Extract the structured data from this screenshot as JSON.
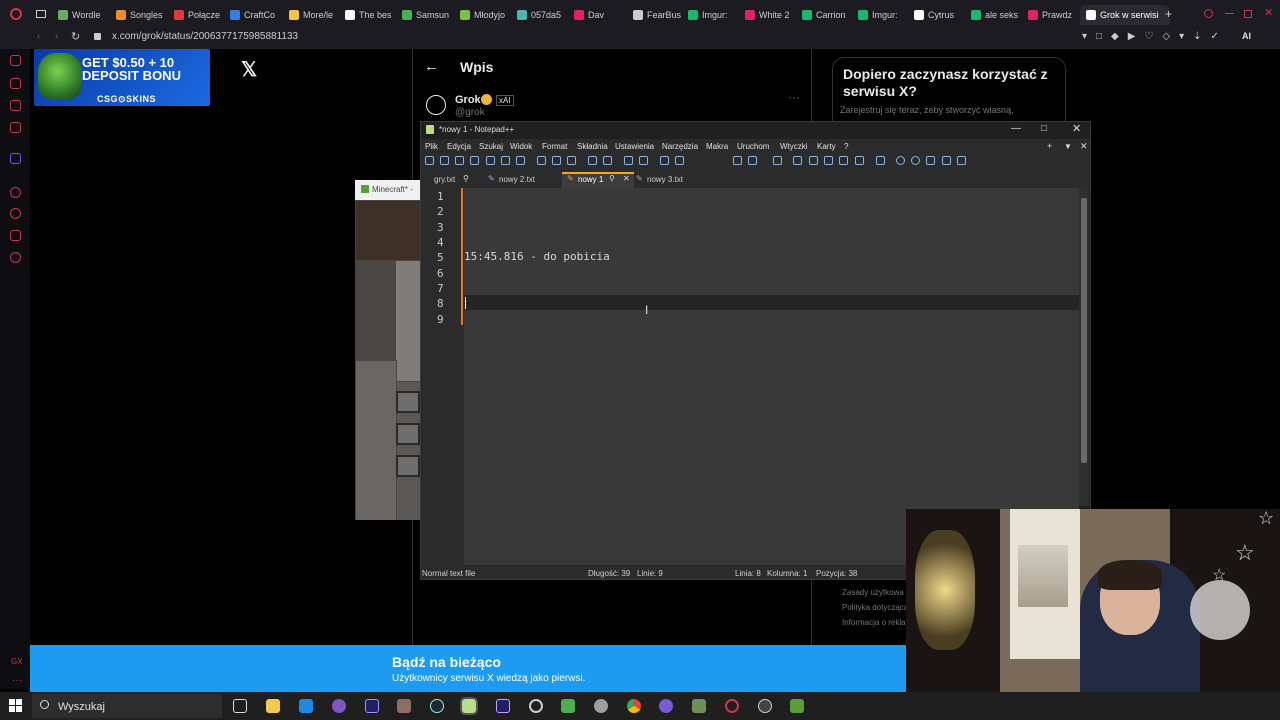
{
  "browser": {
    "tabs": [
      {
        "label": "Wordle",
        "color": "#6aaa64"
      },
      {
        "label": "Songles",
        "color": "#f08c2c"
      },
      {
        "label": "Połącze",
        "color": "#e23a3a"
      },
      {
        "label": "CraftCo",
        "color": "#3a7de2"
      },
      {
        "label": "More/le",
        "color": "#f5c542"
      },
      {
        "label": "The bes",
        "color": "#ffffff"
      },
      {
        "label": "Samsun",
        "color": "#4caf50"
      },
      {
        "label": "Młodyjo",
        "color": "#7bc043"
      },
      {
        "label": "057da5",
        "color": "#4db6ac"
      },
      {
        "label": "Dav",
        "color": "#e0245e"
      },
      {
        "label": "FearBus",
        "color": "#cccccc"
      },
      {
        "label": "Imgur:",
        "color": "#1bb76e"
      },
      {
        "label": "White 2",
        "color": "#e0245e"
      },
      {
        "label": "Carrion",
        "color": "#1bb76e"
      },
      {
        "label": "Imgur:",
        "color": "#1bb76e"
      },
      {
        "label": "Cytrus",
        "color": "#ffffff"
      },
      {
        "label": "ale seks",
        "color": "#1bb76e"
      },
      {
        "label": "Prawdz",
        "color": "#e0245e"
      },
      {
        "label": "Grok w serwisi",
        "color": "#ffffff"
      }
    ],
    "url": "x.com/grok/status/2006377175985881133"
  },
  "ad": {
    "line1": "GET $0.50 + 10",
    "line2": "DEPOSIT BONU",
    "brand": "CSG⊙SKINS"
  },
  "twitter": {
    "logo": "𝕏",
    "back": "←",
    "header": "Wpis",
    "author_name": "Grok",
    "author_handle": "@grok",
    "affiliate": "xAI",
    "more": "···",
    "signup_title": "Dopiero zaczynasz korzystać z serwisu X?",
    "signup_sub": "Zarejestruj się teraz, żeby stworzyć własną,",
    "footer": [
      "Zasady użytkowa",
      "Polityka dotycząca",
      "Informacja o reklam"
    ],
    "banner_title": "Bądź na bieżąco",
    "banner_sub": "Użytkownicy serwisu X wiedzą jako pierwsi."
  },
  "minecraft": {
    "title": "Minecraft* -"
  },
  "npp": {
    "title": "*nowy 1 - Notepad++",
    "menu": [
      "Plik",
      "Edycja",
      "Szukaj",
      "Widok",
      "Format",
      "Składnia",
      "Ustawienia",
      "Narzędzia",
      "Makra",
      "Uruchom",
      "Wtyczki",
      "Karty",
      "?"
    ],
    "tabs": [
      "gry.txt",
      "nowy 2.txt",
      "nowy 1",
      "nowy 3.txt"
    ],
    "line_numbers": [
      "1",
      "2",
      "3",
      "4",
      "5",
      "6",
      "7",
      "8",
      "9"
    ],
    "line5": "15:45.816 - do pobicia",
    "status": {
      "type": "Normal text file",
      "length": "Długość: 39",
      "lines": "Linie: 9",
      "line": "Linia: 8",
      "column": "Kolumna: 1",
      "position": "Pozycja: 38"
    }
  },
  "taskbar": {
    "search": "Wyszukaj"
  }
}
